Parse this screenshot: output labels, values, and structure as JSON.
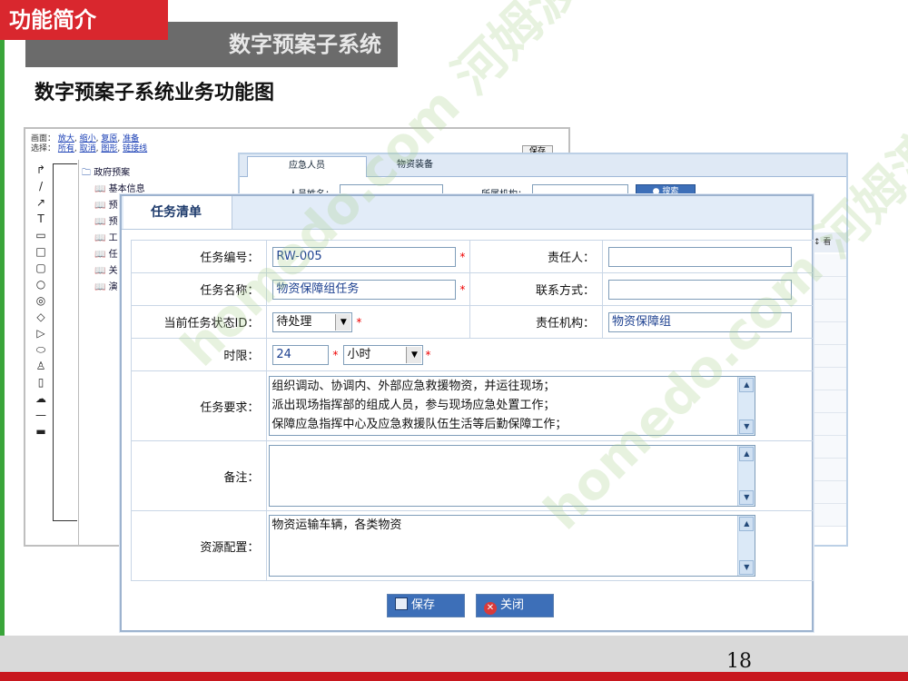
{
  "slide": {
    "tag": "功能简介",
    "section_title": "数字预案子系统",
    "subtitle": "数字预案子系统业务功能图",
    "page_number": "18",
    "watermark": "homedo.com 河姆渡"
  },
  "editor_window": {
    "row1_label": "画面：",
    "row1_links": [
      "放大",
      "缩小",
      "复原",
      "准备"
    ],
    "row2_label": "选择：",
    "row2_links": [
      "所有",
      "取消",
      "图形",
      "链接线"
    ],
    "save_label": "保存",
    "tools": [
      "↱",
      "/",
      "↗",
      "T",
      "▭",
      "□",
      "▢",
      "○",
      "◎",
      "◇",
      "▷",
      "⬭",
      "♙",
      "▯",
      "☁",
      "—",
      "▬"
    ],
    "tree_root": "政府预案",
    "tree_items": [
      "基本信息",
      "预",
      "预",
      "工",
      "任",
      "关",
      "演"
    ]
  },
  "grid_window": {
    "tabs": [
      "应急人员",
      "物资装备"
    ],
    "search": {
      "person_label": "人员姓名：",
      "org_label": "所属机构：",
      "button": "搜索"
    },
    "side_header": "↕ 看"
  },
  "dialog": {
    "title": "任务清单",
    "fields": {
      "task_no_label": "任务编号：",
      "task_no_value": "RW-005",
      "owner_label": "责任人：",
      "owner_value": "",
      "task_name_label": "任务名称：",
      "task_name_value": "物资保障组任务",
      "contact_label": "联系方式：",
      "contact_value": "",
      "status_label": "当前任务状态ID：",
      "status_value": "待处理",
      "org_label": "责任机构：",
      "org_value": "物资保障组",
      "limit_label": "时限：",
      "limit_value": "24",
      "limit_unit": "小时",
      "req_label": "任务要求：",
      "req_lines": [
        "组织调动、协调内、外部应急救援物资，并运往现场；",
        "派出现场指挥部的组成人员，参与现场应急处置工作；",
        "保障应急指挥中心及应急救援队伍生活等后勤保障工作；"
      ],
      "note_label": "备注：",
      "note_value": "",
      "resource_label": "资源配置：",
      "resource_value": "物资运输车辆，各类物资"
    },
    "required_mark": "*",
    "save_button": "保存",
    "close_button": "关闭"
  }
}
